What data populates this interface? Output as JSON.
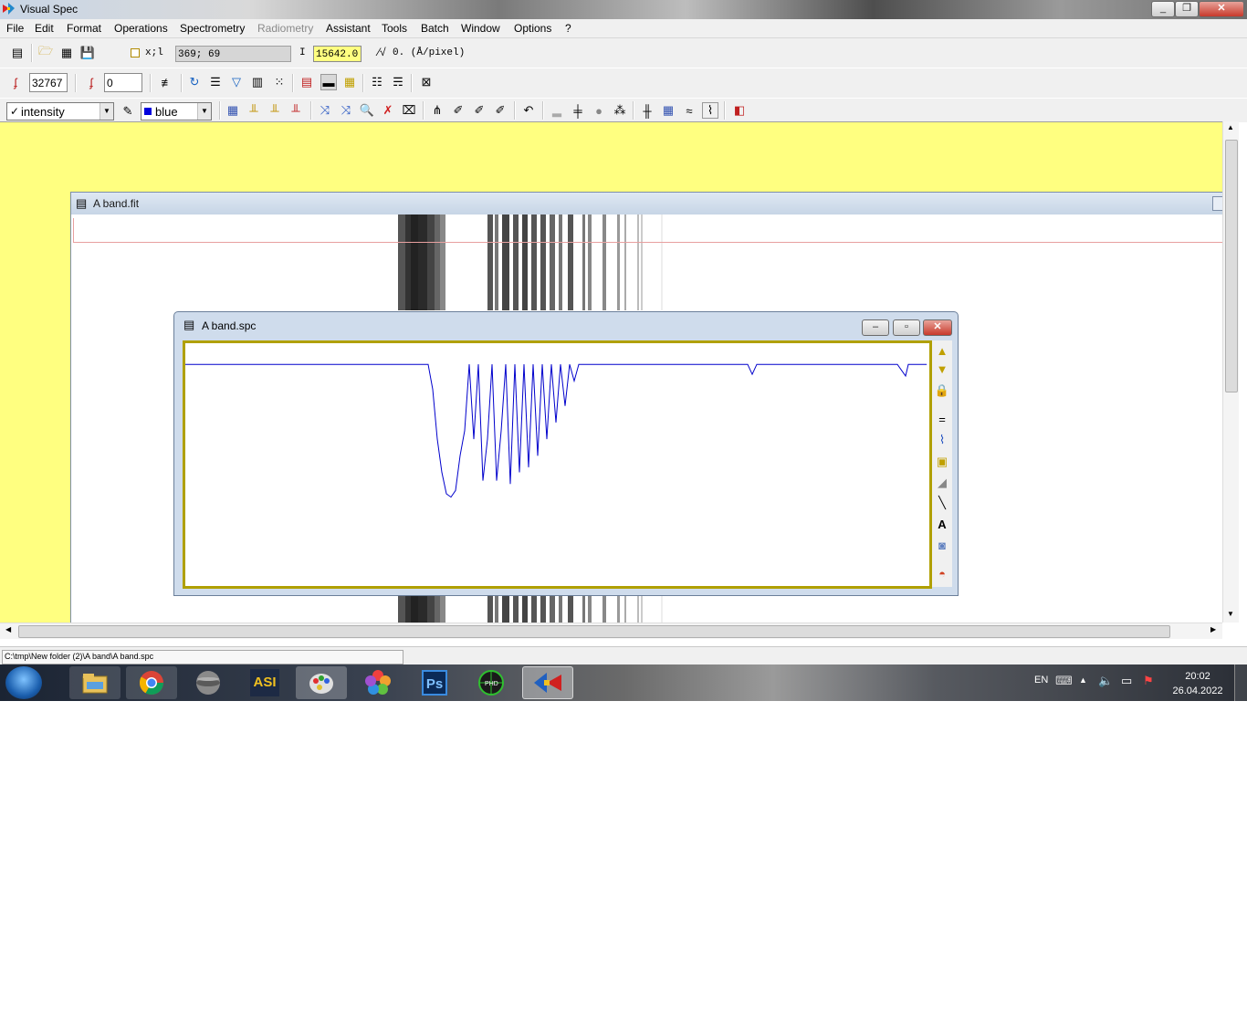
{
  "window": {
    "title": "Visual Spec"
  },
  "menu": [
    "File",
    "Edit",
    "Format",
    "Operations",
    "Spectrometry",
    "Radiometry",
    "Assistant",
    "Tools",
    "Batch",
    "Window",
    "Options",
    "?"
  ],
  "toolbar1": {
    "xl_label": "x;l",
    "coords": "369; 69",
    "i_label": "I",
    "intensity_value": "15642.0",
    "dispersion_label": "0. (Å/pixel)"
  },
  "toolbar2": {
    "max_value": "32767",
    "min_value": "0"
  },
  "toolbar3": {
    "profile_select": "intensity",
    "color_select": "blue"
  },
  "fit_window": {
    "title": "A band.fit"
  },
  "spc_window": {
    "title": "A band.spc"
  },
  "chart_data": {
    "type": "line",
    "title": "",
    "xlabel": "",
    "ylabel": "",
    "color": "#0000cc",
    "x": [
      0,
      10,
      20,
      30,
      40,
      45,
      50,
      55,
      60,
      65,
      70,
      75,
      80,
      85,
      90,
      95,
      100,
      105,
      110,
      115,
      120,
      125,
      130,
      135,
      140,
      145,
      150,
      155,
      160,
      165,
      170,
      175,
      180,
      185,
      190,
      195,
      200,
      205,
      210,
      220,
      230,
      240,
      250,
      260,
      270,
      280,
      290,
      300,
      310,
      320,
      330,
      340,
      350,
      360,
      370,
      380,
      390,
      395,
      400,
      405,
      410,
      420,
      430
    ],
    "y": [
      1.0,
      1.0,
      1.0,
      1.0,
      1.0,
      0.85,
      0.55,
      0.35,
      0.22,
      0.2,
      0.24,
      0.45,
      0.6,
      1.0,
      0.55,
      1.0,
      0.3,
      0.55,
      1.0,
      0.3,
      0.6,
      1.0,
      0.28,
      1.0,
      0.35,
      1.0,
      0.38,
      1.0,
      0.45,
      1.0,
      0.55,
      1.0,
      0.65,
      1.0,
      0.75,
      1.0,
      0.9,
      1.0,
      1.0,
      1.0,
      1.0,
      1.0,
      1.0,
      1.0,
      1.0,
      1.0,
      1.0,
      1.0,
      1.0,
      1.0,
      1.0,
      1.0,
      1.0,
      1.0,
      1.0,
      1.0,
      1.0,
      0.94,
      1.0,
      1.0,
      1.0,
      1.0,
      1.0
    ],
    "ylim": [
      0,
      1.1
    ]
  },
  "status": {
    "path": "C:\\tmp\\New folder (2)\\A band\\A band.spc"
  },
  "taskbar": {
    "language": "EN",
    "time": "20:02",
    "date": "26.04.2022",
    "apps": [
      "explorer-icon",
      "chrome-icon",
      "planet-icon",
      "asi-icon",
      "paint-icon",
      "photos-icon",
      "photoshop-icon",
      "phd-icon",
      "visualspec-icon"
    ]
  }
}
